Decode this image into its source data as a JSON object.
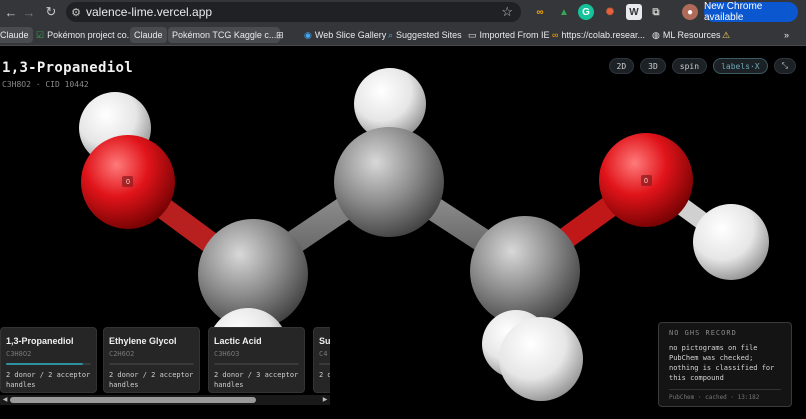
{
  "browser": {
    "url": "valence-lime.vercel.app",
    "new_chrome_label": "New Chrome available",
    "bookmarks": [
      {
        "label": "Claude",
        "chip": true
      },
      {
        "label": "Pokémon project co...",
        "chip": false
      },
      {
        "label": "Claude",
        "chip": true
      },
      {
        "label": "Pokémon TCG Kaggle c...",
        "chip": true
      },
      {
        "label": "Web Slice Gallery",
        "chip": false
      },
      {
        "label": "Suggested Sites",
        "chip": false
      },
      {
        "label": "Imported From IE",
        "chip": false
      },
      {
        "label": "https://colab.resear...",
        "chip": false
      },
      {
        "label": "ML Resources",
        "chip": false
      }
    ],
    "more_label": "»"
  },
  "molecule": {
    "name": "1,3-Propanediol",
    "meta": "C3H8O2 · CID 10442",
    "atom_label": "O"
  },
  "controls": [
    "2D",
    "3D",
    "spin",
    "labels·X",
    "⤡"
  ],
  "cards": [
    {
      "name": "1,3-Propanediol",
      "formula": "C3H8O2",
      "desc": "2 donor / 2 acceptor handles",
      "fill": 0.9
    },
    {
      "name": "Ethylene Glycol",
      "formula": "C2H6O2",
      "desc": "2 donor / 2 acceptor handles",
      "fill": 0.0
    },
    {
      "name": "Lactic Acid",
      "formula": "C3H6O3",
      "desc": "2 donor / 3 acceptor handles",
      "fill": 0.0
    },
    {
      "name": "Su",
      "formula": "C4",
      "desc": "2 d ha",
      "fill": 0.0
    }
  ],
  "ghs": {
    "heading": "NO GHS RECORD",
    "body": "no pictograms on file PubChem was checked; nothing is classified for this compound",
    "footer": "PubChem · cached · 13:182"
  },
  "colors": {
    "oxygen": "#e0141a",
    "carbon": "#8e8e8e",
    "hydrogen": "#f2f2f2",
    "accent": "#2e8fa0"
  }
}
